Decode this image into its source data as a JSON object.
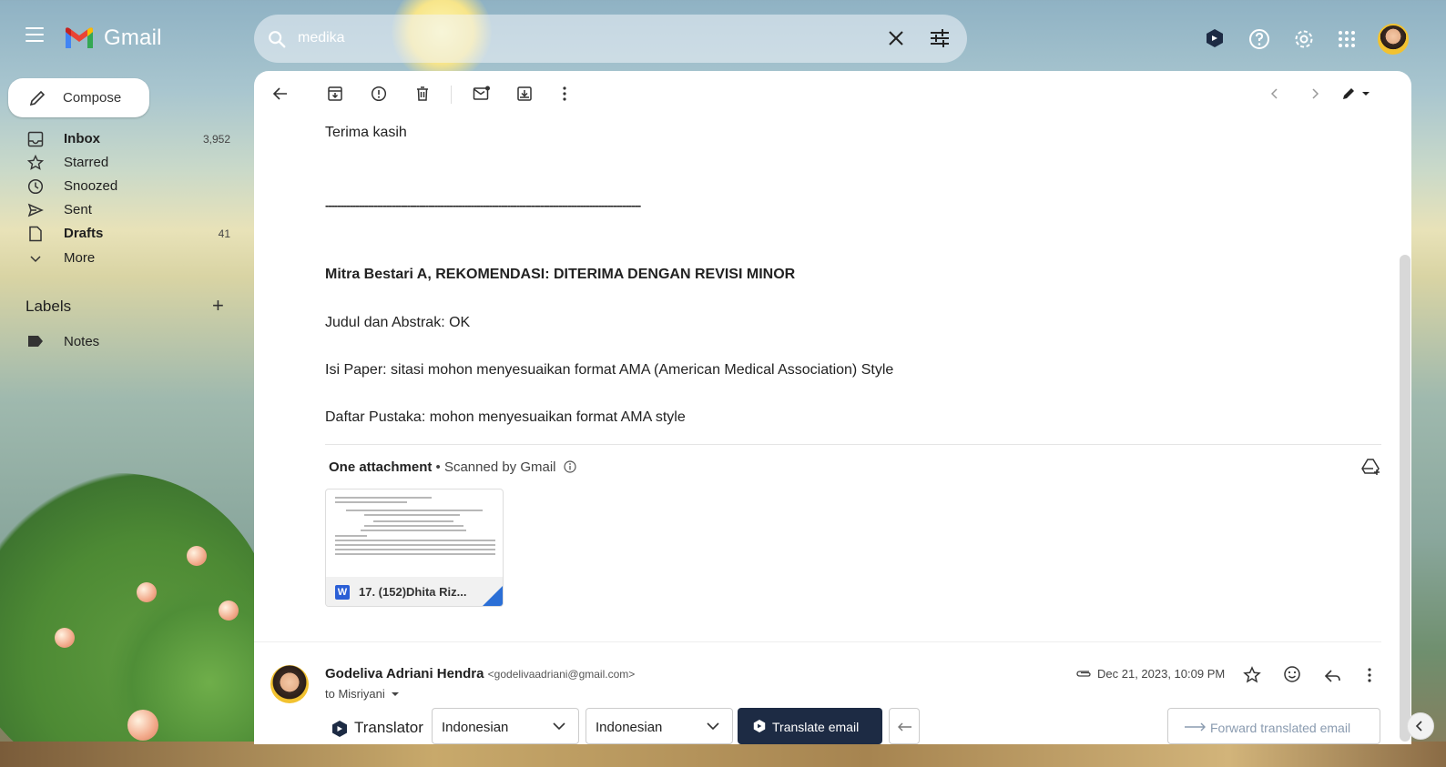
{
  "app": {
    "name": "Gmail"
  },
  "colors": {
    "accent": "#1d2b44",
    "gmail_red": "#ea4335",
    "gmail_blue": "#4285f4",
    "gmail_green": "#34a853",
    "gmail_yellow": "#fbbc04",
    "word_blue": "#2b5fd6"
  },
  "search": {
    "value": "medika"
  },
  "sidebar": {
    "compose_label": "Compose",
    "items": [
      {
        "label": "Inbox",
        "count": "3,952",
        "icon": "inbox-icon",
        "bold": true
      },
      {
        "label": "Starred",
        "count": "",
        "icon": "star-icon",
        "bold": false
      },
      {
        "label": "Snoozed",
        "count": "",
        "icon": "clock-icon",
        "bold": false
      },
      {
        "label": "Sent",
        "count": "",
        "icon": "send-icon",
        "bold": false
      },
      {
        "label": "Drafts",
        "count": "41",
        "icon": "draft-icon",
        "bold": true
      },
      {
        "label": "More",
        "count": "",
        "icon": "chevron-down-icon",
        "bold": false
      }
    ],
    "labels_title": "Labels",
    "labels_add": "+",
    "labels": [
      {
        "label": "Notes",
        "icon": "label-icon"
      }
    ]
  },
  "email": {
    "lines": [
      "Terima kasih",
      "Judul dan Abstrak: OK",
      "Isi Paper: sitasi mohon menyesuaikan format AMA (American Medical Association) Style",
      "Daftar Pustaka: mohon menyesuaikan format AMA style"
    ],
    "dashes": "--------------------------------------------------------------------------------------------------------",
    "heading": "Mitra Bestari A,  REKOMENDASI: DITERIMA DENGAN REVISI MINOR",
    "attachment_header": "One attachment",
    "attachment_scanned": "  •  Scanned by Gmail",
    "attachment": {
      "name": "17. (152)Dhita Riz...",
      "type_badge": "W"
    }
  },
  "message": {
    "sender_name": "Godeliva Adriani Hendra",
    "sender_email": "<godelivaadriani@gmail.com>",
    "to": "to Misriyani",
    "date": "Dec 21, 2023, 10:09 PM"
  },
  "translator": {
    "label": "Translator",
    "source_lang": "Indonesian",
    "target_lang": "Indonesian",
    "translate_button": "Translate email",
    "forward_button": "Forward translated email"
  }
}
